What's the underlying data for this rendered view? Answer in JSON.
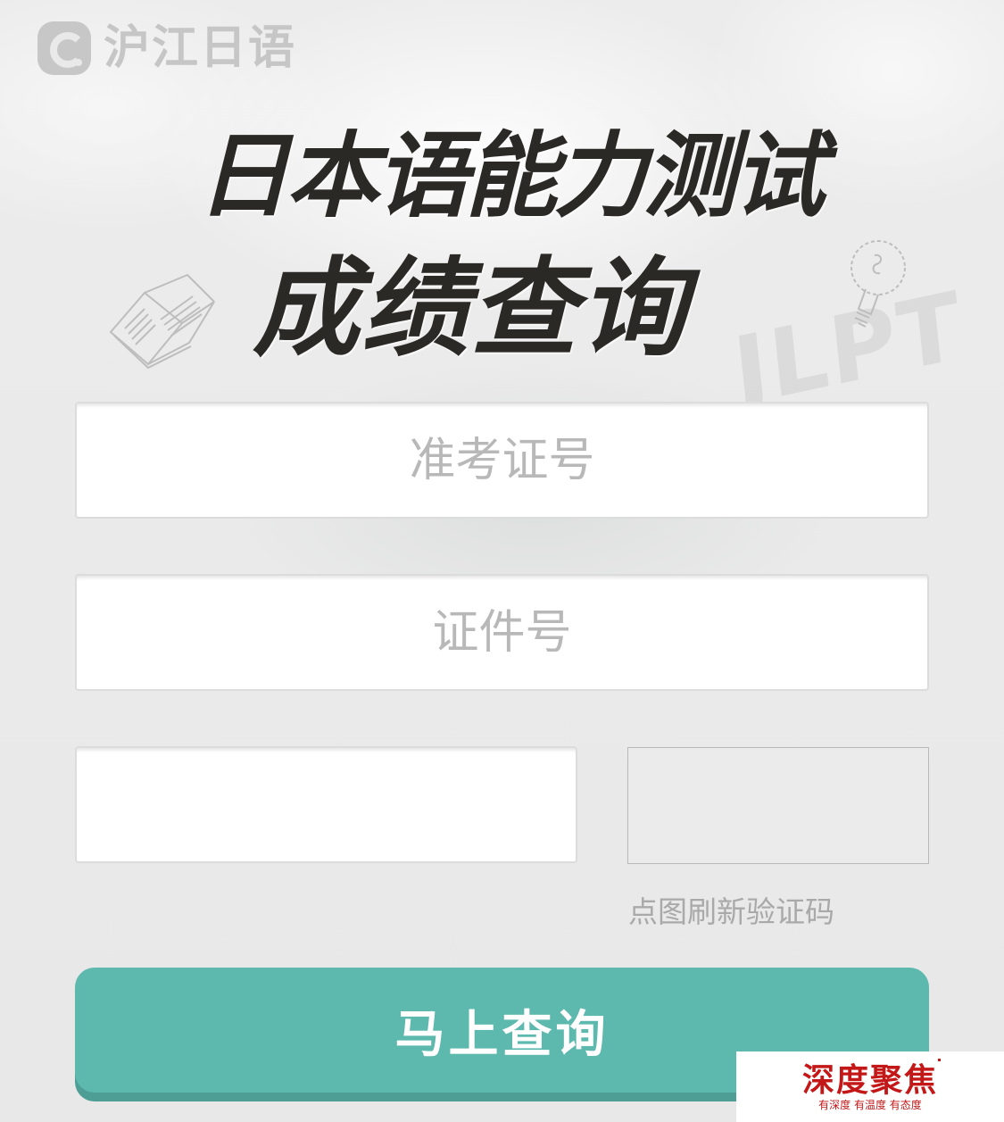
{
  "logo": {
    "text": "沪江日语",
    "icon": "hujiang-logo-icon"
  },
  "headline": {
    "line1": "日本语能力测试",
    "line2": "成绩查询",
    "watermark": "JLPT"
  },
  "form": {
    "exam_number_placeholder": "准考证号",
    "id_number_placeholder": "证件号",
    "captcha_input_placeholder": "",
    "captcha_hint": "点图刷新验证码",
    "submit_label": "马上查询"
  },
  "decorations": {
    "left": "open-book-icon",
    "right": "light-bulb-icon"
  },
  "badge": {
    "title": "深度聚焦",
    "subtitle": "有深度 有温度 有态度"
  },
  "colors": {
    "accent": "#5db8ad",
    "title": "#2b2926",
    "badge_red": "#c41818"
  }
}
